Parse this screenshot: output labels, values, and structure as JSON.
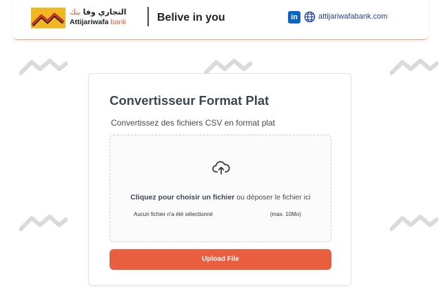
{
  "header": {
    "logo_arabic": "التجاري وفا",
    "logo_arabic_bank": "بنك",
    "logo_name": "Attijariwafa",
    "logo_bank": "bank",
    "tagline": "Belive in you",
    "linkedin_label": "in",
    "website": "attijariwafabank.com"
  },
  "card": {
    "title": "Convertisseur Format Plat",
    "subtitle": "Convertissez des fichiers CSV en format plat",
    "dropzone": {
      "choose_label": "Cliquez pour choisir un fichier",
      "drop_label": " ou déposer le fichier ici",
      "no_file": "Aucun fichier n'a été sélectionné",
      "max_size": "(max. 10Mo)"
    },
    "upload_button": "Upload File"
  },
  "colors": {
    "brand_orange": "#e85e3f",
    "brand_yellow": "#f2b620",
    "linkedin": "#0a66c2"
  }
}
